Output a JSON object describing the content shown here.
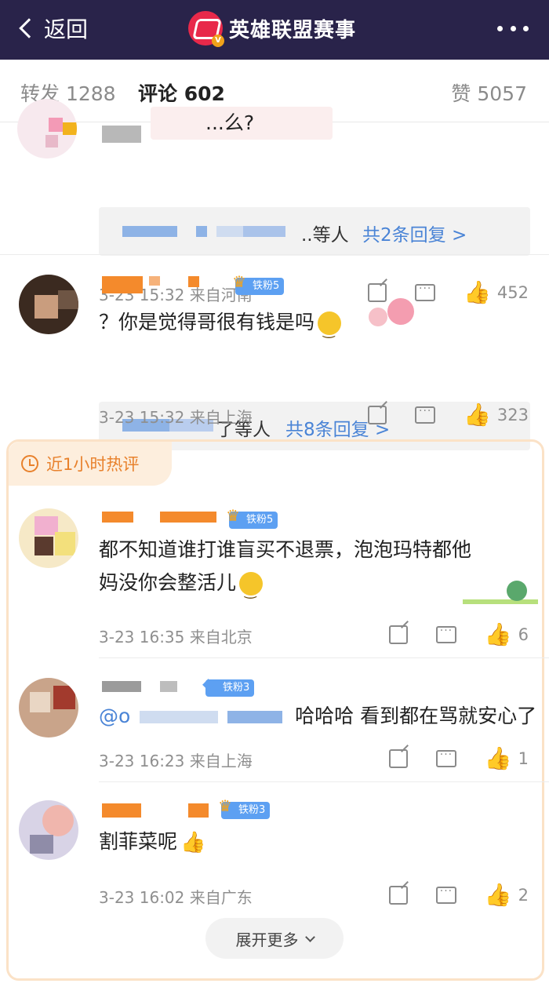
{
  "header": {
    "back_label": "返回",
    "title": "英雄联盟赛事",
    "logo_icon": "lpl-logo-icon",
    "more_icon": "more-dots-icon"
  },
  "tabs": {
    "repost": "转发 1288",
    "comments": "评论 602",
    "likes": "赞 5057"
  },
  "comments": [
    {
      "content": "...么?",
      "reply_summary_suffix": "..等人",
      "reply_count": "共2条回复 >",
      "time_location": "3-23 15:32 来自河南",
      "likes": "452"
    },
    {
      "fan_badge": "铁粉5",
      "content": "？你是觉得哥很有钱是吗",
      "reply_summary_suffix": "了等人",
      "reply_count": "共8条回复 >",
      "time_location": "3-23 15:32 来自上海",
      "likes": "323"
    }
  ],
  "hot_section": {
    "label": "近1小时热评",
    "comments": [
      {
        "fan_badge": "铁粉5",
        "content_line1": "都不知道谁打谁盲买不退票，泡泡玛特都他",
        "content_line2": "妈没你会整活儿",
        "time_location": "3-23 16:35 来自北京",
        "likes": "6"
      },
      {
        "fan_badge": "铁粉3",
        "mention": "@o",
        "content": "哈哈哈 看到都在骂就安心了",
        "time_location": "3-23 16:23 来自上海",
        "likes": "1"
      },
      {
        "fan_badge": "铁粉3",
        "content": "割菲菜呢",
        "time_location": "3-23 16:02 来自广东",
        "likes": "2"
      }
    ]
  },
  "expand_more": "展开更多",
  "colors": {
    "header_bg": "#29234a",
    "link_blue": "#4a84d6",
    "hot_orange": "#e8812c",
    "badge_blue": "#5da0f2"
  }
}
